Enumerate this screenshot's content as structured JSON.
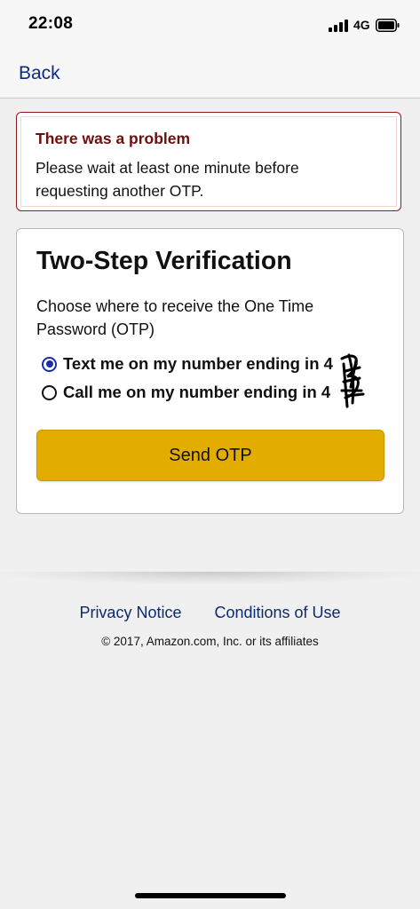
{
  "status_bar": {
    "time": "22:08",
    "network": "4G",
    "icons": [
      "signal-icon",
      "battery-icon"
    ]
  },
  "nav": {
    "back_label": "Back"
  },
  "alert": {
    "title": "There was a problem",
    "message": "Please wait at least one minute before requesting another OTP.",
    "color": "#6e0f0f"
  },
  "verification": {
    "title": "Two-Step Verification",
    "description": "Choose where to receive the One Time Password (OTP)",
    "options": [
      {
        "label": "Text me on my number ending in 4",
        "selected": true
      },
      {
        "label": "Call me on my number ending in 4",
        "selected": false
      }
    ],
    "send_button_label": "Send OTP",
    "button_color": "#e3ad00"
  },
  "footer": {
    "links": [
      "Privacy Notice",
      "Conditions of Use"
    ],
    "copyright": "© 2017, Amazon.com, Inc. or its affiliates"
  }
}
